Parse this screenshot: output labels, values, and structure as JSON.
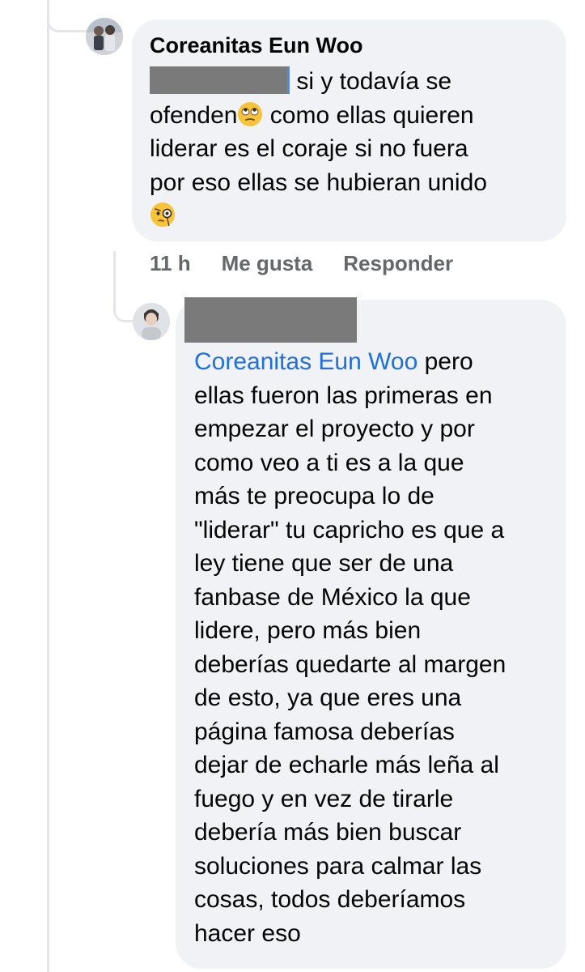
{
  "comment": {
    "author": "Coreanitas Eun Woo",
    "lines": [
      "si y todavía se",
      "ofenden",
      "como ellas quieren",
      "liderar es el coraje  si no fuera",
      "por eso ellas se hubieran unido"
    ],
    "emoji_1": "face-with-rolling-eyes-icon",
    "emoji_2": "face-with-monocle-icon",
    "timestamp": "11 h",
    "like_label": "Me gusta",
    "reply_label": "Responder"
  },
  "reply": {
    "mention": "Coreanitas Eun Woo",
    "first_line_rest": " pero",
    "lines": [
      "ellas fueron las primeras en",
      "empezar el proyecto y por",
      "como veo a ti es a la que",
      "más te preocupa lo de",
      "\"liderar\" tu capricho es que a",
      "ley tiene que ser de una",
      "fanbase de México la que",
      "lidere, pero más bien",
      "deberías quedarte al margen",
      "de esto, ya que eres una",
      "página famosa deberías",
      "dejar de echarle más leña al",
      "fuego y en vez de tirarle",
      "debería más bien buscar",
      "soluciones para calmar las",
      "cosas, todos deberíamos",
      "hacer eso"
    ]
  },
  "colors": {
    "bubble": "#f0f2f5",
    "mention": "#216fdb",
    "meta": "#65676b",
    "redacted": "#7a7a7a"
  }
}
